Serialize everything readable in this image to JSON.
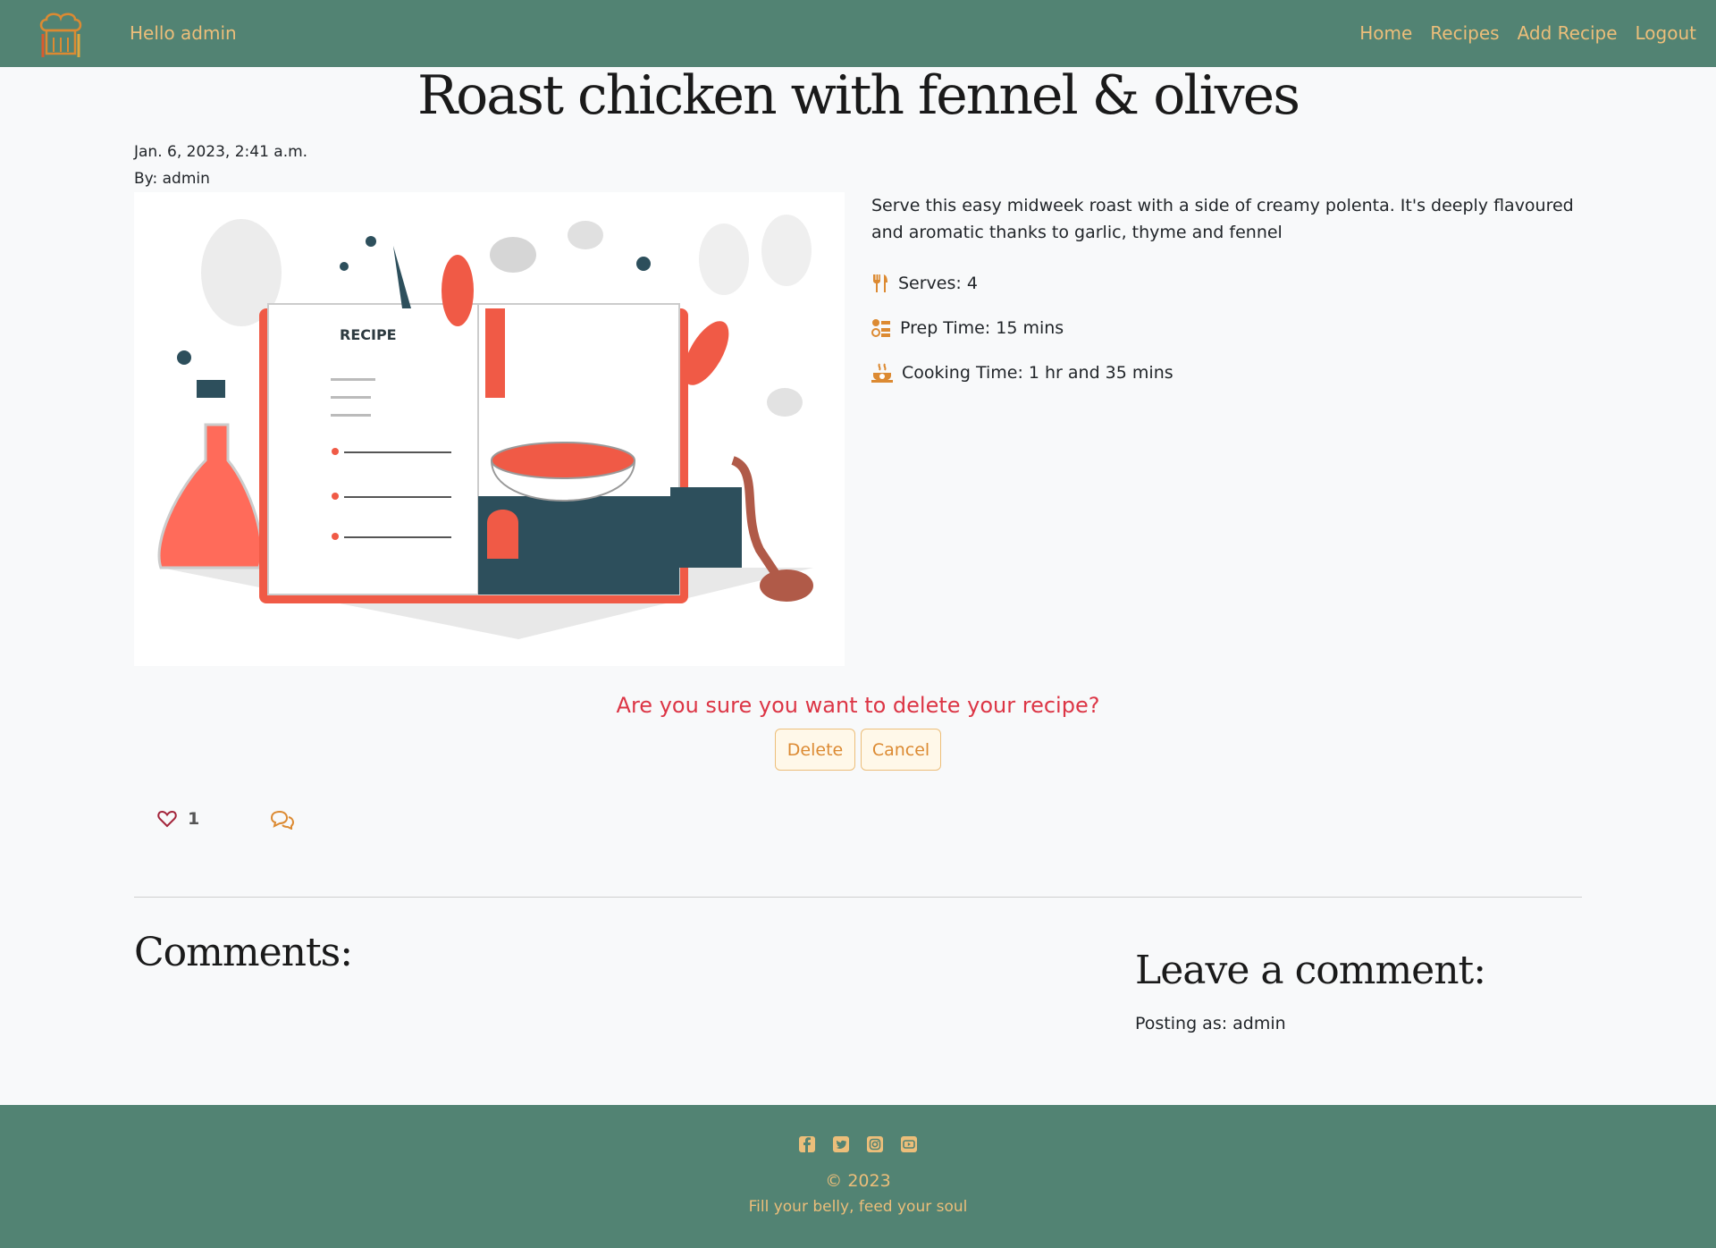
{
  "nav": {
    "greeting": "Hello admin",
    "links": [
      "Home",
      "Recipes",
      "Add Recipe",
      "Logout"
    ]
  },
  "recipe": {
    "title": "Roast chicken with fennel & olives",
    "date": "Jan. 6, 2023, 2:41 a.m.",
    "author": "By: admin",
    "image_label": "RECIPE",
    "description": "Serve this easy midweek roast with a side of creamy polenta. It's deeply flavoured and aromatic thanks to garlic, thyme and fennel",
    "serves": "Serves: 4",
    "prep_time": "Prep Time: 15 mins",
    "cooking_time": "Cooking Time: 1 hr and 35 mins"
  },
  "delete_confirm": {
    "question": "Are you sure you want to delete your recipe?",
    "delete_label": "Delete",
    "cancel_label": "Cancel"
  },
  "engagement": {
    "like_count": "1"
  },
  "comments": {
    "heading": "Comments:",
    "leave_heading": "Leave a comment:",
    "posting_as": "Posting as: admin"
  },
  "footer": {
    "copyright": "© 2023",
    "tagline": "Fill your belly, feed your soul",
    "socials": [
      "facebook-icon",
      "twitter-icon",
      "instagram-icon",
      "youtube-icon"
    ]
  },
  "colors": {
    "nav_bg": "#528373",
    "accent": "#ecbe7a",
    "danger": "#dc3545",
    "icon_orange": "#dc8a32"
  }
}
